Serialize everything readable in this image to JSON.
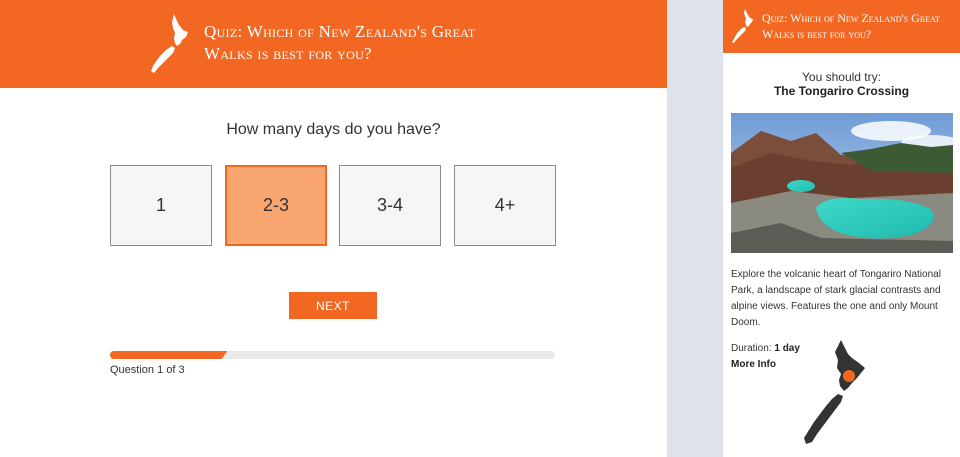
{
  "quiz": {
    "title": "Quiz: Which of New Zealand's Great Walks is best for you?",
    "question": "How many days do you have?",
    "options": [
      "1",
      "2-3",
      "3-4",
      "4+"
    ],
    "selected_option": "2-3",
    "next_label": "NEXT",
    "progress_text": "Question 1 of 3",
    "progress_fraction": 0.264
  },
  "result": {
    "title": "Quiz: Which of New Zealand's Great Walks is best for you?",
    "try_label": "You should try:",
    "name": "The Tongariro Crossing",
    "description": "Explore the volcanic heart of Tongariro National Park, a landscape of stark glacial contrasts and alpine views. Features the one and only Mount Doom.",
    "duration_label": "Duration:",
    "duration_value": "1 day",
    "more_info": "More Info"
  },
  "colors": {
    "brand_orange": "#f26722",
    "selected_fill": "#f9a670",
    "gutter": "#dfe3ec"
  },
  "icons": [
    "new-zealand-map-icon",
    "location-marker-icon"
  ]
}
